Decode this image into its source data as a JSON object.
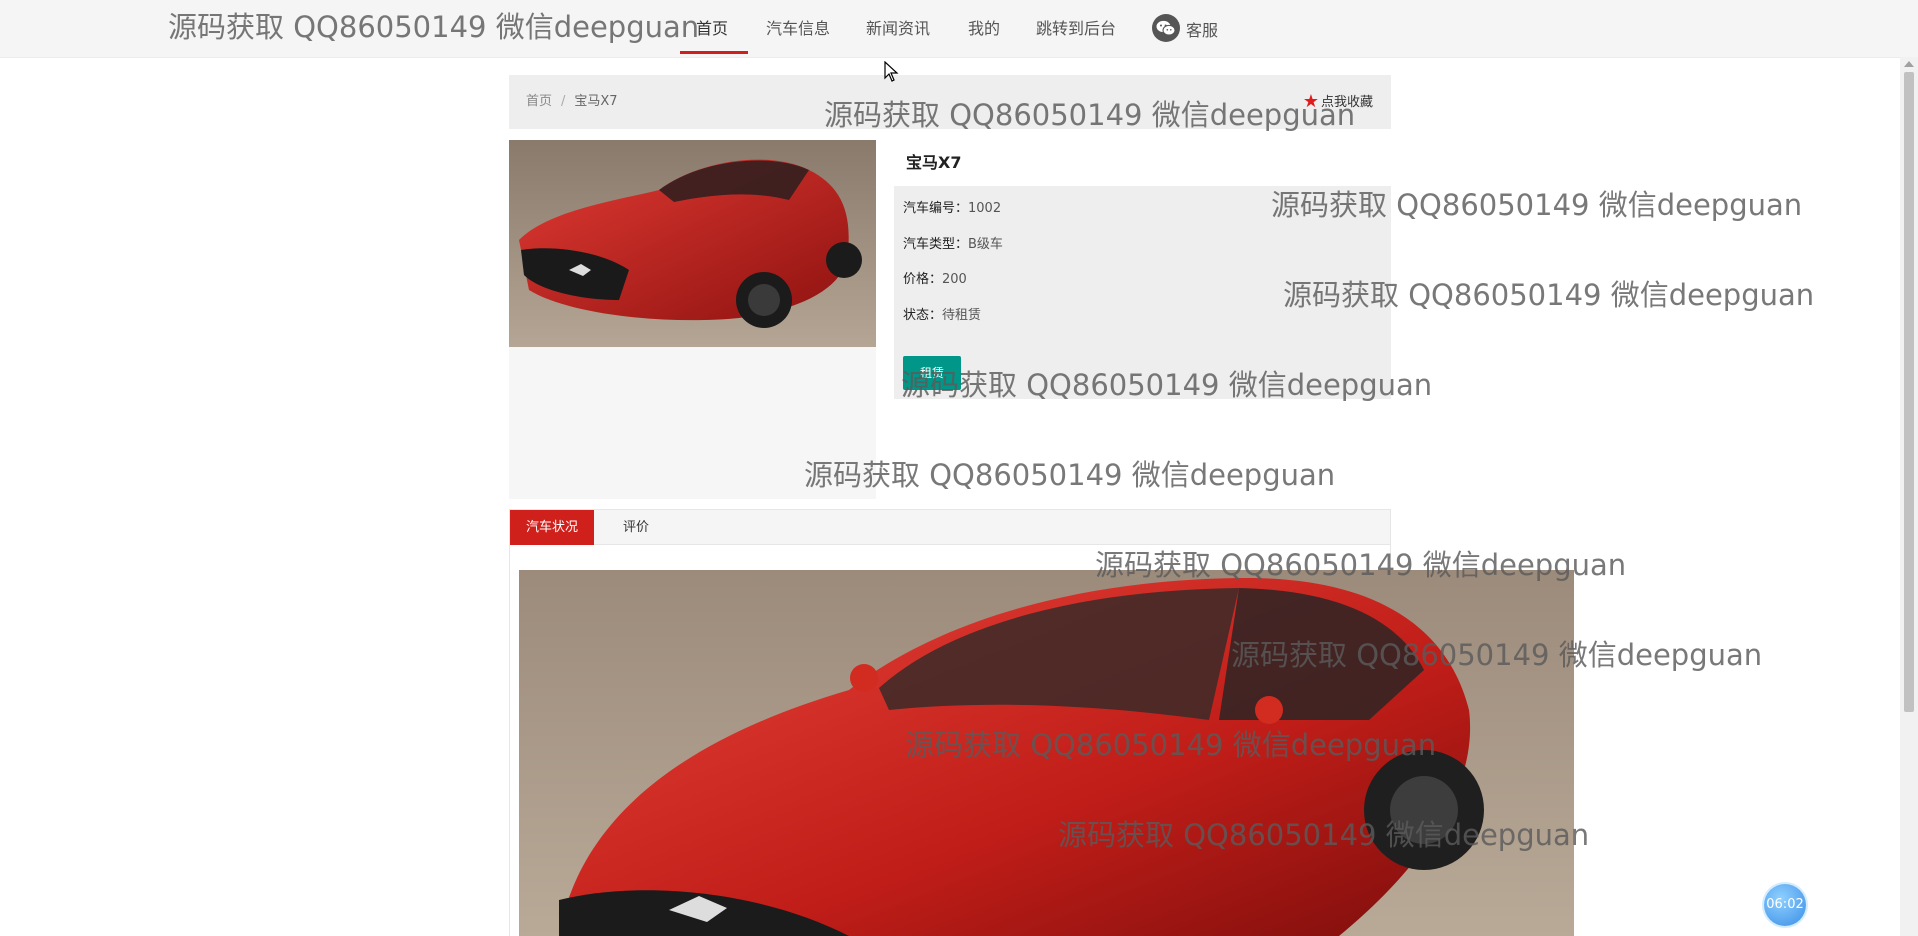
{
  "nav": {
    "items": [
      {
        "label": "首页",
        "active": true
      },
      {
        "label": "汽车信息",
        "active": false
      },
      {
        "label": "新闻资讯",
        "active": false
      },
      {
        "label": "我的",
        "active": false
      },
      {
        "label": "跳转到后台",
        "active": false
      },
      {
        "label": "客服",
        "active": false,
        "icon": "wechat-icon"
      }
    ]
  },
  "breadcrumb": {
    "home": "首页",
    "separator": "/",
    "current": "宝马X7"
  },
  "favorite": {
    "icon": "star-icon",
    "label": "点我收藏"
  },
  "car": {
    "name": "宝马X7",
    "fields": [
      {
        "label": "汽车编号：",
        "value": "1002"
      },
      {
        "label": "汽车类型：",
        "value": "B级车"
      },
      {
        "label": "价格：",
        "value": "200"
      },
      {
        "label": "状态：",
        "value": "待租赁"
      }
    ],
    "rent_button": "租赁"
  },
  "tabs": [
    {
      "label": "汽车状况",
      "active": true
    },
    {
      "label": "评价",
      "active": false
    }
  ],
  "watermark": "源码获取 QQ86050149 微信deepguan",
  "timer": "06:02",
  "colors": {
    "accent_red": "#d0201c",
    "button_teal": "#009688",
    "timer_blue": "#3a8ee6"
  }
}
